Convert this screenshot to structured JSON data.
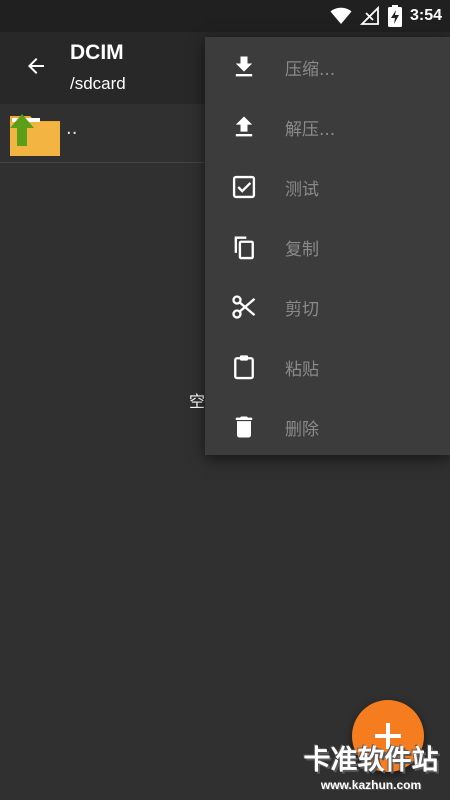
{
  "status_bar": {
    "time": "3:54",
    "icons": [
      "wifi-icon",
      "signal-off-icon",
      "battery-charging-icon"
    ]
  },
  "toolbar": {
    "title": "DCIM",
    "subtitle": "/sdcard",
    "back_icon": "arrow-left-icon"
  },
  "file_list": {
    "parent_item": {
      "label": "..",
      "icon": "folder-up-icon"
    },
    "empty_text": "空"
  },
  "menu": {
    "items": [
      {
        "label": "压缩...",
        "icon": "download-icon"
      },
      {
        "label": "解压...",
        "icon": "upload-icon"
      },
      {
        "label": "测试",
        "icon": "checkbox-icon"
      },
      {
        "label": "复制",
        "icon": "copy-icon"
      },
      {
        "label": "剪切",
        "icon": "scissors-icon"
      },
      {
        "label": "粘贴",
        "icon": "clipboard-icon"
      },
      {
        "label": "删除",
        "icon": "trash-icon"
      }
    ]
  },
  "fab": {
    "icon": "plus-icon"
  },
  "watermark": {
    "title": "卡准软件站",
    "url": "www.kazhun.com"
  },
  "colors": {
    "background": "#303030",
    "toolbar": "#282828",
    "menu": "#3c3c3c",
    "fab": "#f57c1f",
    "folder": "#f0a830",
    "folder_arrow": "#5a9e1a"
  }
}
